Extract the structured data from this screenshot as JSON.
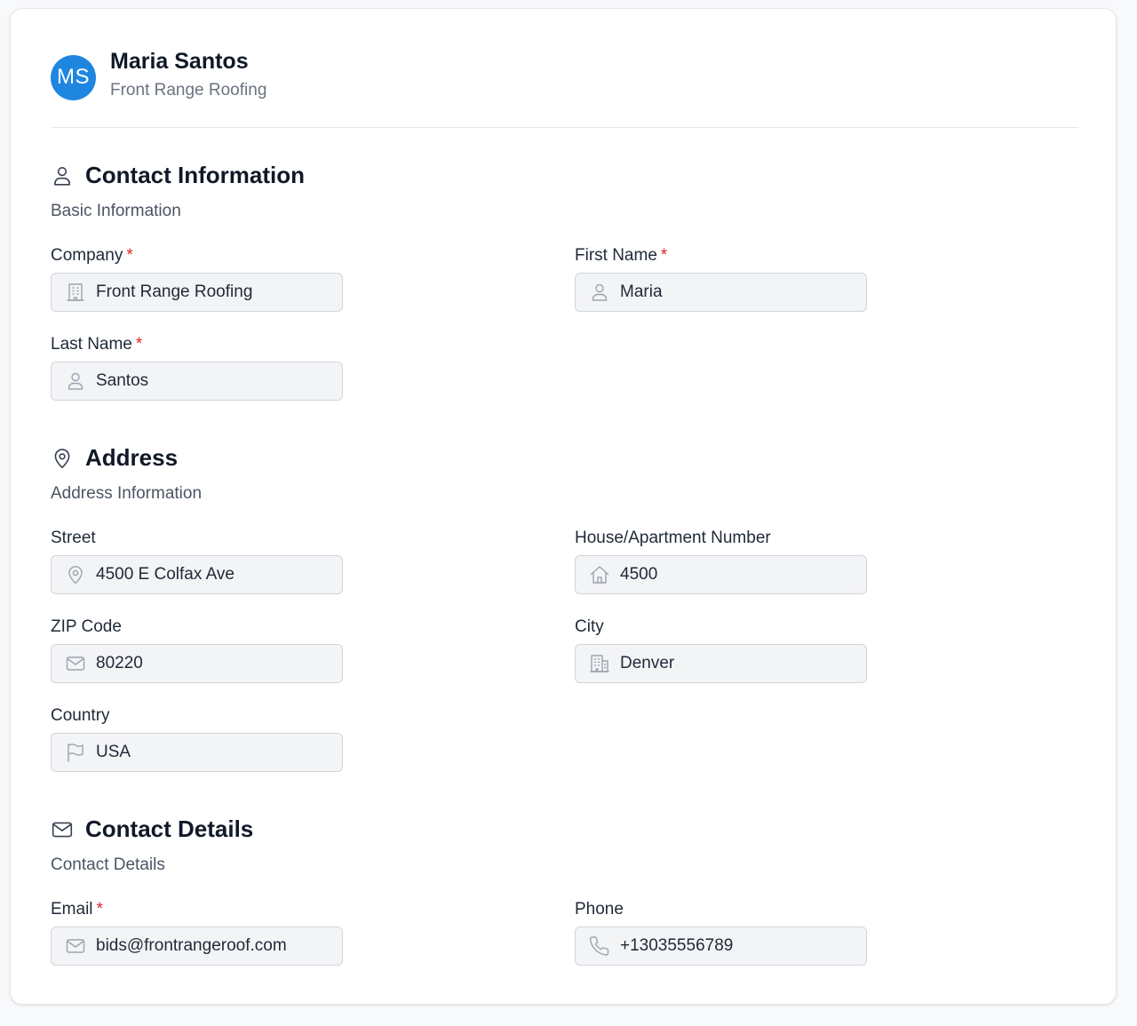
{
  "header": {
    "initials": "MS",
    "name": "Maria Santos",
    "company": "Front Range Roofing",
    "avatar_color": "#1f86e0"
  },
  "sections": {
    "contact_info": {
      "title": "Contact Information",
      "subtitle": "Basic Information",
      "icon": "user-icon"
    },
    "address": {
      "title": "Address",
      "subtitle": "Address Information",
      "icon": "map-pin-icon"
    },
    "contact_details": {
      "title": "Contact Details",
      "subtitle": "Contact Details",
      "icon": "mail-icon"
    }
  },
  "fields": {
    "company": {
      "label": "Company",
      "required": "*",
      "value": "Front Range Roofing",
      "icon": "building-icon"
    },
    "first_name": {
      "label": "First Name",
      "required": "*",
      "value": "Maria",
      "icon": "user-icon"
    },
    "last_name": {
      "label": "Last Name",
      "required": "*",
      "value": "Santos",
      "icon": "user-icon"
    },
    "street": {
      "label": "Street",
      "value": "4500 E Colfax Ave",
      "icon": "map-pin-icon"
    },
    "house_number": {
      "label": "House/Apartment Number",
      "value": "4500",
      "icon": "home-icon"
    },
    "zip": {
      "label": "ZIP Code",
      "value": "80220",
      "icon": "mail-icon"
    },
    "city": {
      "label": "City",
      "value": "Denver",
      "icon": "buildings-icon"
    },
    "country": {
      "label": "Country",
      "value": "USA",
      "icon": "flag-icon"
    },
    "email": {
      "label": "Email",
      "required": "*",
      "value": "bids@frontrangeroof.com",
      "icon": "mail-icon"
    },
    "phone": {
      "label": "Phone",
      "value": "+13035556789",
      "icon": "phone-icon"
    }
  },
  "colors": {
    "required": "#dc2626",
    "field_bg": "#f3f4f6",
    "field_border": "#d1d5db",
    "muted_text": "#6b7280"
  }
}
